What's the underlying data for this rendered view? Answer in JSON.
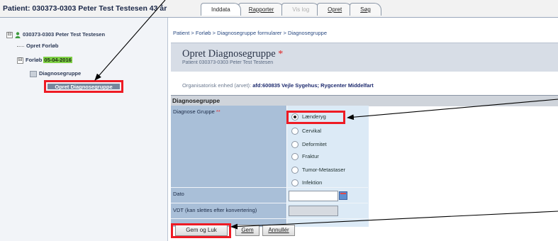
{
  "header": {
    "patient_title": "Patient: 030373-0303 Peter Test Testesen 43 år",
    "tabs": [
      {
        "label": "Inddata",
        "state": "active"
      },
      {
        "label": "Rapporter",
        "state": "normal"
      },
      {
        "label": "Vis log",
        "state": "disabled"
      },
      {
        "label": "Opret",
        "state": "normal"
      },
      {
        "label": "Søg",
        "state": "normal"
      }
    ]
  },
  "tree": {
    "root_label": "030373-0303 Peter Test Testesen",
    "root_expander": "⊟",
    "opret_forloeb": "Opret Forløb",
    "forloeb_prefix": "Forløb",
    "forloeb_date": "05-04-2016",
    "forloeb_expander": "⊟",
    "diagnosegruppe": "Diagnosegruppe",
    "selected_item": "Opret Diagnosegruppe"
  },
  "breadcrumb": "Patient > Forløb > Diagnosegruppe formularer > Diagnosegruppe",
  "form": {
    "title": "Opret Diagnosegruppe",
    "required_star": "*",
    "subtitle": "Patient 030373-0303 Peter Test Testesen",
    "org_label": "Organisatorisk enhed (arvet):",
    "org_value": "afd:600835 Vejle Sygehus; Rygcenter Middelfart",
    "section_title": "Diagnosegruppe",
    "diagnose_label": "Diagnose Gruppe",
    "diagnose_required": "**",
    "options": [
      {
        "label": "Lænderyg",
        "checked": true
      },
      {
        "label": "Cervikal",
        "checked": false
      },
      {
        "label": "Deformitet",
        "checked": false
      },
      {
        "label": "Fraktur",
        "checked": false
      },
      {
        "label": "Tumor-Metastaser",
        "checked": false
      },
      {
        "label": "Infektion",
        "checked": false
      }
    ],
    "dato_label": "Dato",
    "dato_value": "",
    "vdt_label": "VDT (kan slettes efter konvertering)",
    "vdt_value": ""
  },
  "buttons": {
    "gem_og_luk": "Gem og Luk",
    "gem": "Gem",
    "annuller": "Annullér"
  },
  "colors": {
    "highlight_red": "#ee1b24",
    "date_highlight": "#7fd046",
    "label_column": "#a9bfd8",
    "value_column": "#dceaf6"
  }
}
